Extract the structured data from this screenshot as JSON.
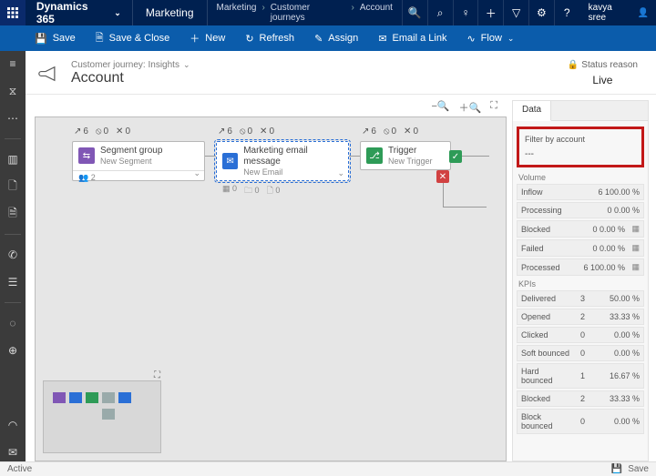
{
  "topbar": {
    "brand": "Dynamics 365",
    "area": "Marketing",
    "crumbs": [
      "Marketing",
      "Customer journeys",
      "Account"
    ],
    "user": "kavya sree"
  },
  "cmdbar": {
    "save": "Save",
    "save_close": "Save & Close",
    "new": "New",
    "refresh": "Refresh",
    "assign": "Assign",
    "email": "Email a Link",
    "flow": "Flow"
  },
  "page": {
    "sub": "Customer journey: Insights",
    "title": "Account",
    "status_label": "Status reason",
    "status_value": "Live"
  },
  "canvas": {
    "counters": [
      {
        "a": "6",
        "b": "0",
        "c": "0"
      },
      {
        "a": "6",
        "b": "0",
        "c": "0"
      },
      {
        "a": "6",
        "b": "0",
        "c": "0"
      }
    ],
    "nodes": [
      {
        "title": "Segment group",
        "sub": "New Segment",
        "color": "#8057b5",
        "foot_count": "2"
      },
      {
        "title": "Marketing email message",
        "sub": "New Email",
        "color": "#2a6fd6",
        "foot": [
          "0",
          "0",
          "0"
        ]
      },
      {
        "title": "Trigger",
        "sub": "New Trigger",
        "color": "#2e9b57"
      }
    ]
  },
  "panel": {
    "tab": "Data",
    "filter_label": "Filter by account",
    "filter_value": "---",
    "volume_label": "Volume",
    "volume": [
      {
        "k": "Inflow",
        "v": "6 100.00 %",
        "ic": false
      },
      {
        "k": "Processing",
        "v": "0 0.00 %",
        "ic": false
      },
      {
        "k": "Blocked",
        "v": "0 0.00 %",
        "ic": true
      },
      {
        "k": "Failed",
        "v": "0 0.00 %",
        "ic": true
      },
      {
        "k": "Processed",
        "v": "6 100.00 %",
        "ic": true
      }
    ],
    "kpi_label": "KPIs",
    "kpis": [
      {
        "k": "Delivered",
        "n": "3",
        "p": "50.00 %"
      },
      {
        "k": "Opened",
        "n": "2",
        "p": "33.33 %"
      },
      {
        "k": "Clicked",
        "n": "0",
        "p": "0.00 %"
      },
      {
        "k": "Soft bounced",
        "n": "0",
        "p": "0.00 %"
      },
      {
        "k": "Hard bounced",
        "n": "1",
        "p": "16.67 %"
      },
      {
        "k": "Blocked",
        "n": "2",
        "p": "33.33 %"
      },
      {
        "k": "Block bounced",
        "n": "0",
        "p": "0.00 %"
      }
    ]
  },
  "footer": {
    "status": "Active",
    "save": "Save"
  }
}
